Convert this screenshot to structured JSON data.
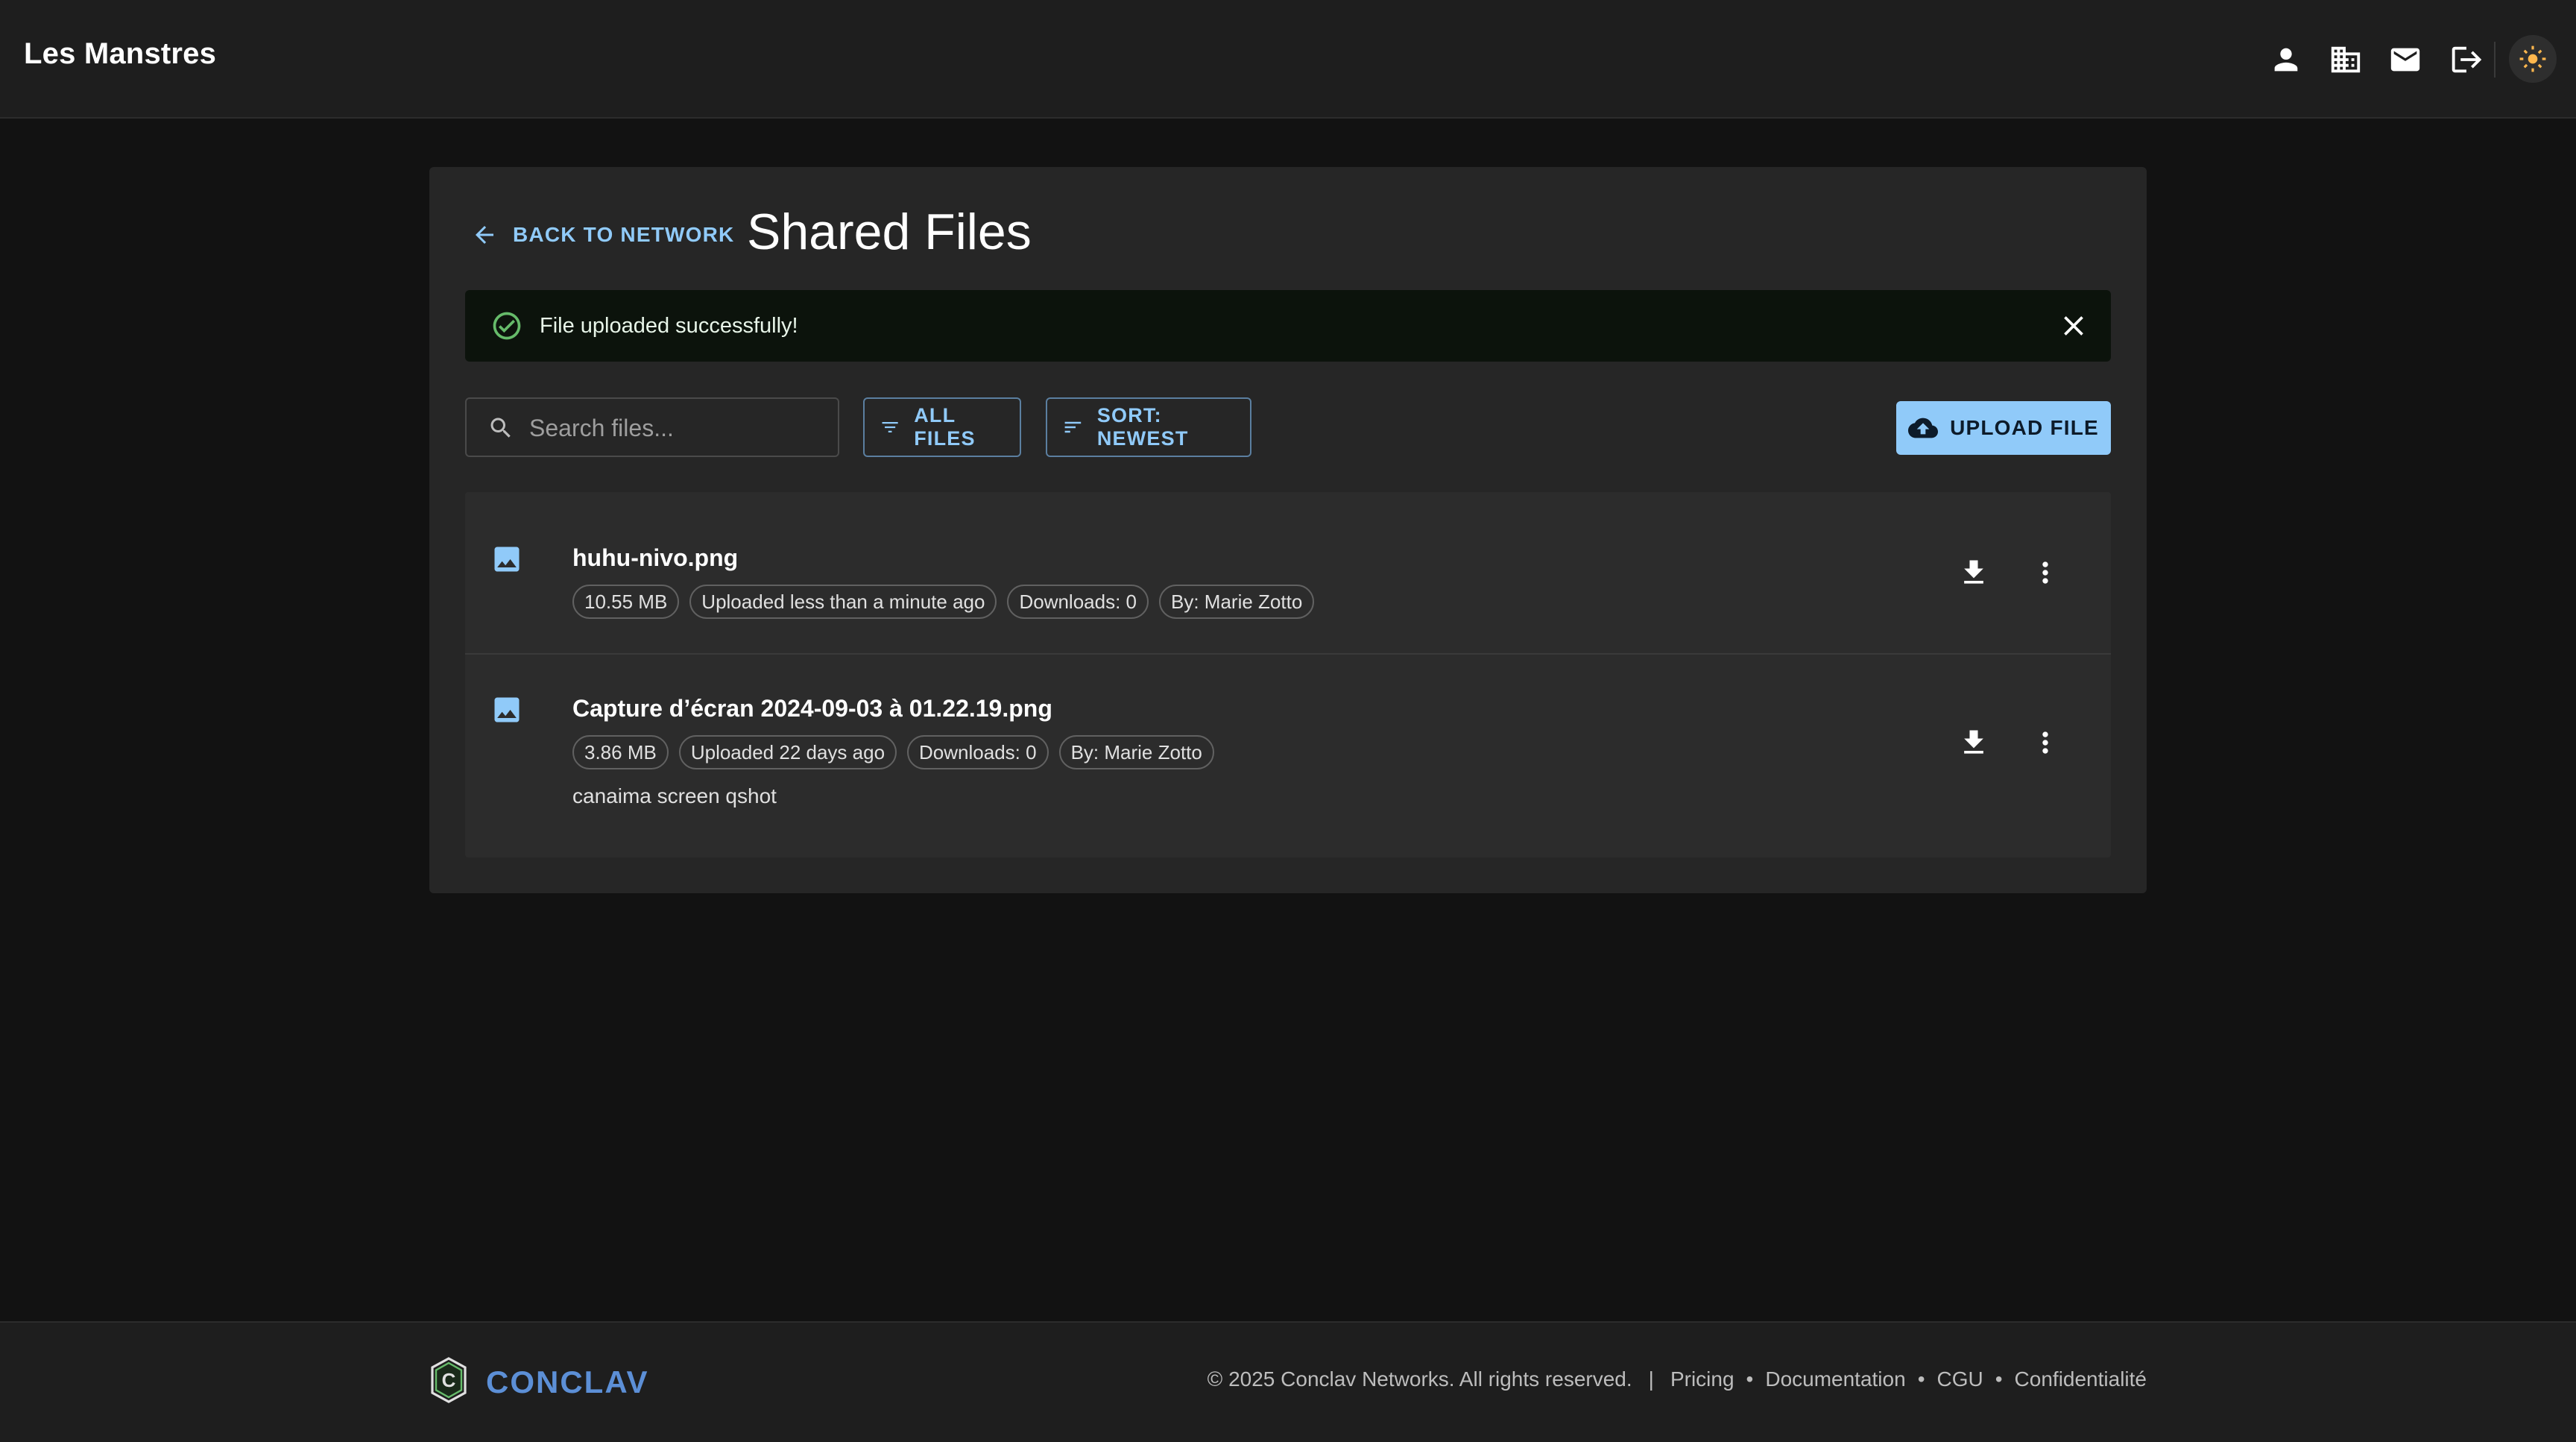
{
  "header": {
    "brand": "Les Manstres",
    "icons": [
      "person-icon",
      "building-icon",
      "mail-icon",
      "logout-icon",
      "sun-icon"
    ]
  },
  "page": {
    "back_label": "BACK TO NETWORK",
    "title": "Shared Files"
  },
  "alert": {
    "message": "File uploaded successfully!",
    "color": "#66bb6a"
  },
  "toolbar": {
    "search_placeholder": "Search files...",
    "filter_label": "ALL FILES",
    "sort_label": "SORT: NEWEST",
    "upload_label": "UPLOAD FILE"
  },
  "files": [
    {
      "name": "huhu-nivo.png",
      "size": "10.55 MB",
      "uploaded": "Uploaded less than a minute ago",
      "downloads": "Downloads: 0",
      "by": "By: Marie Zotto",
      "description": ""
    },
    {
      "name": "Capture d’écran 2024-09-03 à 01.22.19.png",
      "size": "3.86 MB",
      "uploaded": "Uploaded 22 days ago",
      "downloads": "Downloads: 0",
      "by": "By: Marie Zotto",
      "description": "canaima screen qshot"
    }
  ],
  "footer": {
    "logo_text": "CONCLAV",
    "copyright": "© 2025 Conclav Networks. All rights reserved.",
    "separator": "|",
    "links": [
      "Pricing",
      "Documentation",
      "CGU",
      "Confidentialité"
    ],
    "dot": "•"
  },
  "colors": {
    "accent": "#90caf9",
    "background": "#121212",
    "surface": "#262626",
    "brand": "#5c8fd6"
  }
}
